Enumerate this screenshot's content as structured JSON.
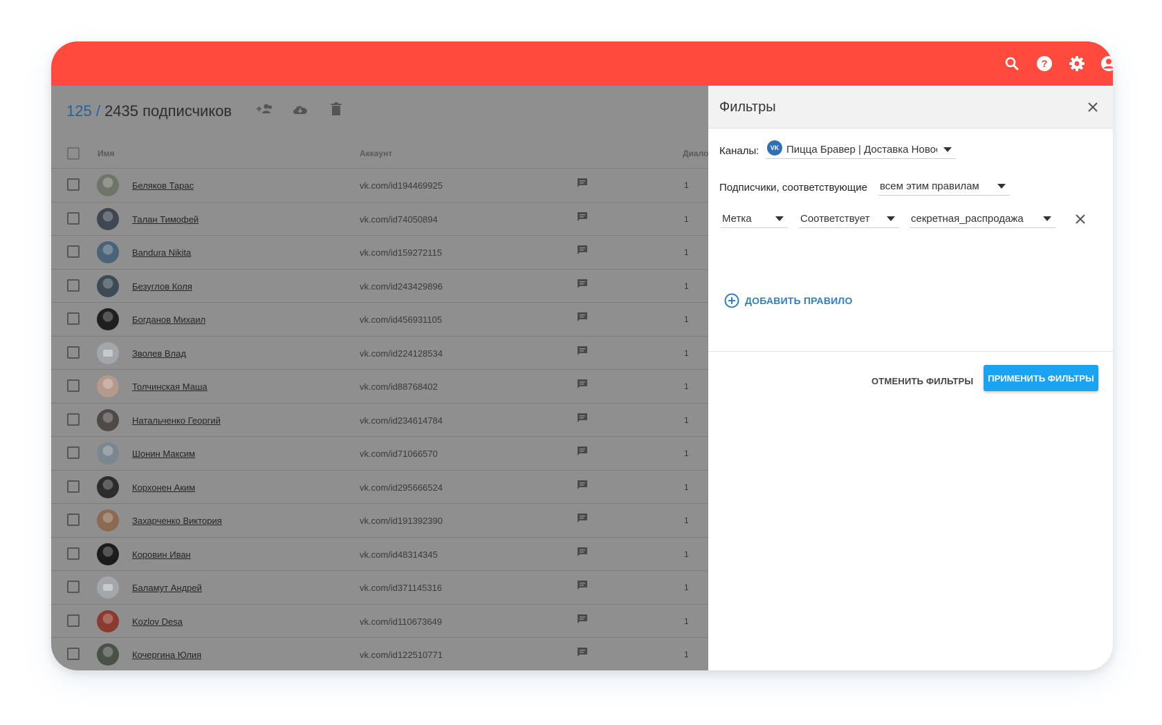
{
  "topbar": {
    "color": "#ff4a3d",
    "icons": [
      "search-icon",
      "help-icon",
      "gear-icon",
      "account-icon"
    ]
  },
  "list": {
    "selected_count": "125",
    "separator": " / ",
    "total_label": "2435 подписчиков",
    "toolbar_icons": [
      "add-people-icon",
      "cloud-download-icon",
      "trash-icon"
    ],
    "columns": {
      "name": "Имя",
      "account": "Аккаунт",
      "dialogs": "Диалоги"
    },
    "rows": [
      {
        "name": "Беляков Тарас",
        "account": "vk.com/id194469925",
        "count": "1",
        "avatar": "#6f7568"
      },
      {
        "name": "Талан Тимофей",
        "account": "vk.com/id74050894",
        "count": "1",
        "avatar": "#3f4752"
      },
      {
        "name": "Bandura Nikita",
        "account": "vk.com/id159272115",
        "count": "1",
        "avatar": "#4a6377"
      },
      {
        "name": "Безуглов Коля",
        "account": "vk.com/id243429896",
        "count": "1",
        "avatar": "#3b4a55"
      },
      {
        "name": "Богданов Михаил",
        "account": "vk.com/id456931105",
        "count": "1",
        "avatar": "#1f1f1f"
      },
      {
        "name": "Зволев Влад",
        "account": "vk.com/id224128534",
        "count": "1",
        "avatar": ""
      },
      {
        "name": "Толчинская Маша",
        "account": "vk.com/id88768402",
        "count": "1",
        "avatar": "#b49a8c"
      },
      {
        "name": "Натальченко Георгий",
        "account": "vk.com/id234614784",
        "count": "1",
        "avatar": "#4d4a48"
      },
      {
        "name": "Шонин Максим",
        "account": "vk.com/id71066570",
        "count": "1",
        "avatar": "#7b8790"
      },
      {
        "name": "Корхонен Аким",
        "account": "vk.com/id295666524",
        "count": "1",
        "avatar": "#2c2c2c"
      },
      {
        "name": "Захарченко Виктория",
        "account": "vk.com/id191392390",
        "count": "1",
        "avatar": "#8a6a52"
      },
      {
        "name": "Коровин Иван",
        "account": "vk.com/id48314345",
        "count": "1",
        "avatar": "#1c1c1c"
      },
      {
        "name": "Баламут Андрей",
        "account": "vk.com/id371145316",
        "count": "1",
        "avatar": ""
      },
      {
        "name": "Kozlov Desa",
        "account": "vk.com/id110673649",
        "count": "1",
        "avatar": "#8a3a2e"
      },
      {
        "name": "Кочергина Юлия",
        "account": "vk.com/id122510771",
        "count": "1",
        "avatar": "#4a5148"
      }
    ]
  },
  "filters": {
    "title": "Фильтры",
    "channels_label": "Каналы:",
    "channel_badge": "VK",
    "channel_value": "Пицца Бравер | Доставка Новосибирск",
    "subscribers_label": "Подписчики, соответствующие",
    "match_value": "всем этим правилам",
    "rule": {
      "field": "Метка",
      "operator": "Соответствует",
      "value": "секретная_распродажа"
    },
    "add_rule_label": "ДОБАВИТЬ ПРАВИЛО",
    "cancel_label": "ОТМЕНИТЬ ФИЛЬТРЫ",
    "apply_label": "ПРИМЕНИТЬ ФИЛЬТРЫ",
    "accent": "#1aa3f2"
  }
}
